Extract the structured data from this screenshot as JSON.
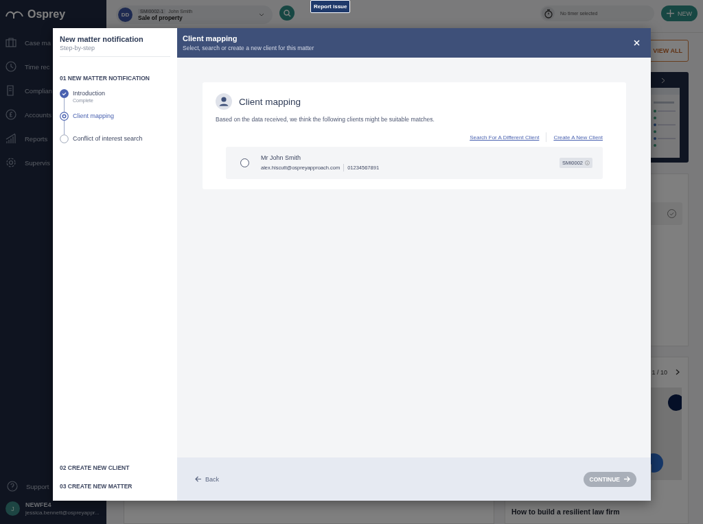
{
  "app": {
    "logo": "Osprey",
    "nav": [
      {
        "label": "Case ma"
      },
      {
        "label": "Time rec"
      },
      {
        "label": "Complian"
      },
      {
        "label": "Accounts"
      },
      {
        "label": "Reports"
      },
      {
        "label": "Supervis"
      }
    ],
    "support": "Support",
    "user": {
      "initial": "J",
      "name": "NEWFE4",
      "email": "jessica.bennett@ospreyappr..."
    }
  },
  "topbar": {
    "matter": {
      "initials": "DD",
      "ref": "SMI0002-1",
      "client": "John Smith",
      "title": "Sale of property"
    },
    "report_button": "Report issue",
    "timer": "No timer selected",
    "new_button": "NEW"
  },
  "dashboard": {
    "view_all": "VIEW ALL",
    "pager": "1 / 10",
    "article_title": "How to build a resilient law firm"
  },
  "modal": {
    "title": "New matter notification",
    "subtitle": "Step-by-step",
    "sections": [
      {
        "heading": "01 NEW MATTER NOTIFICATION",
        "steps": [
          {
            "label": "Introduction",
            "note": "Complete",
            "completed": true,
            "selected": false
          },
          {
            "label": "Client mapping",
            "completed": false,
            "selected": true
          },
          {
            "label": "Conflict of interest search",
            "completed": false,
            "selected": false
          }
        ]
      },
      {
        "heading": "02 CREATE NEW CLIENT"
      },
      {
        "heading": "03 CREATE NEW MATTER"
      }
    ],
    "header": {
      "title": "Client mapping",
      "subtitle": "Select, search or create a new client for this matter"
    },
    "card": {
      "title": "Client mapping",
      "description": "Based on the data received, we think the following clients might be suitable matches.",
      "links": [
        "Search For A Different Client",
        "Create A New Client"
      ],
      "clients": [
        {
          "name": "Mr John Smith",
          "email": "alex.hiscutt@ospreyapproach.com",
          "phone": "01234567891",
          "ref": "SMI0002",
          "selected": false
        }
      ]
    },
    "back": "Back",
    "continue": {
      "label": "CONTINUE",
      "disabled": true
    }
  }
}
